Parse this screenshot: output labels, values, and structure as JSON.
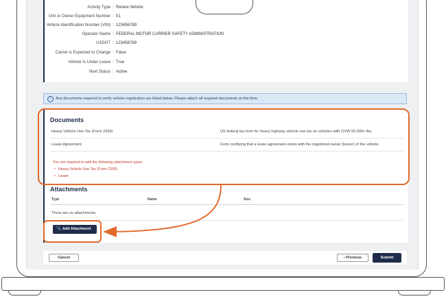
{
  "details": {
    "rows": [
      {
        "label": "Activity Type",
        "value": "Renew Vehicle"
      },
      {
        "label": "Unit or Owner Equipment Number",
        "value": "01"
      },
      {
        "label": "Vehicle Identification Number (VIN)",
        "value": "123456789"
      },
      {
        "label": "Operator Name",
        "value": "FEDERAL MOTOR CARRIER SAFETY ADMINISTRATION"
      },
      {
        "label": "USDOT",
        "value": "123456789"
      },
      {
        "label": "Carrier is Expected to Change",
        "value": "False"
      },
      {
        "label": "Vehicle Is Under Lease",
        "value": "True"
      },
      {
        "label": "Next Status",
        "value": "Active"
      }
    ]
  },
  "info_alert": {
    "icon": "info-circle-icon",
    "text": "Any documents required to verify vehicle registration are listed below. Please attach all required documents at this time."
  },
  "documents": {
    "title": "Documents",
    "rows": [
      {
        "name": "Heavy Vehicle Use Tax (Form 2290)",
        "description": "US federal tax form for heavy highway vehicle use tax on vehicles with GVW 55,000+ lbs."
      },
      {
        "name": "Lease Agreement",
        "description": "Form certifying that a lease agreement exists with the registered owner (lessor) of the vehicle."
      }
    ],
    "required_message": "You are required to add the following attachment types.",
    "required_items": [
      "Heavy Vehicle Use Tax (Form 2290)",
      "Lease"
    ]
  },
  "attachments": {
    "title": "Attachments",
    "columns": [
      "Type",
      "Name",
      "Size"
    ],
    "empty_text": "There are no attachments.",
    "add_button_label": "Add Attachment"
  },
  "footer": {
    "cancel_label": "Cancel",
    "previous_label": "Previous",
    "submit_label": "Submit"
  },
  "colors": {
    "annotation": "#e06a2c",
    "primary": "#1e2b4a",
    "required": "#c0392b",
    "info_bg": "#dbe8f6"
  }
}
